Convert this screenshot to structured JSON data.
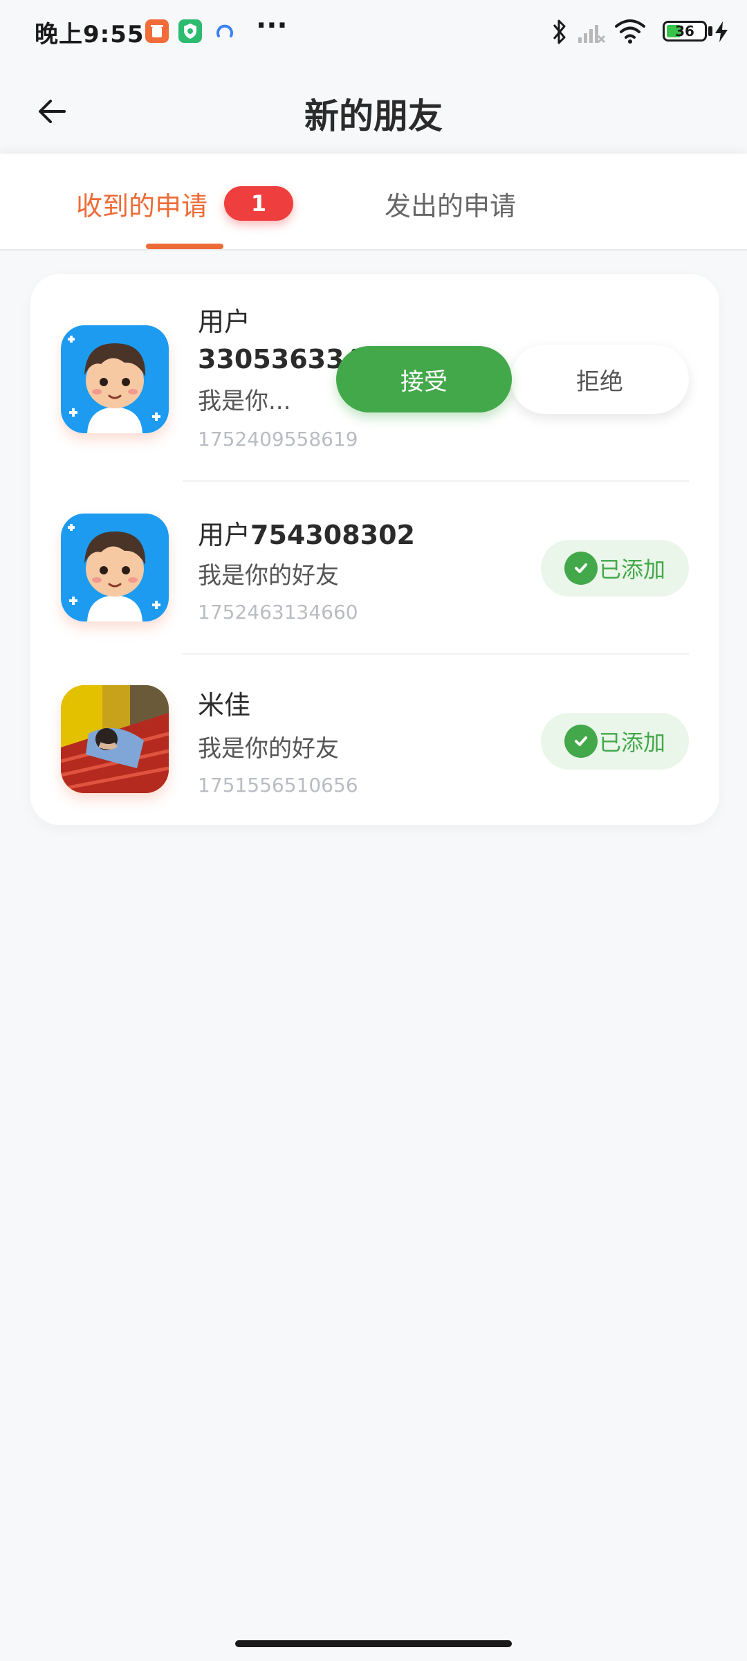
{
  "status_bar": {
    "time": "晚上9:55",
    "dots": "···",
    "battery_level": "36",
    "icons": [
      "app-orange-icon",
      "app-green-shield-icon",
      "app-blue-icon",
      "bluetooth-icon",
      "signal-icon",
      "wifi-icon",
      "battery-icon",
      "charging-icon"
    ]
  },
  "header": {
    "title": "新的朋友",
    "back_icon": "arrow-left-icon"
  },
  "tabs": [
    {
      "label": "收到的申请",
      "badge": "1",
      "active": true
    },
    {
      "label": "发出的申请",
      "active": false
    }
  ],
  "requests": [
    {
      "name_prefix": "用户",
      "name_number": "330536334",
      "message": "我是你...",
      "timestamp": "1752409558619",
      "accept_label": "接受",
      "reject_label": "拒绝"
    },
    {
      "name_prefix": "用户",
      "name_number": "754308302",
      "message": "我是你的好友",
      "timestamp": "1752463134660",
      "status_label": "已添加"
    },
    {
      "name": "米佳",
      "message": "我是你的好友",
      "timestamp": "1751556510656",
      "status_label": "已添加"
    }
  ],
  "colors": {
    "accent": "#ee6b37",
    "badge_red": "#ef3e3e",
    "green": "#43a84a",
    "background": "#f7f8fa"
  }
}
